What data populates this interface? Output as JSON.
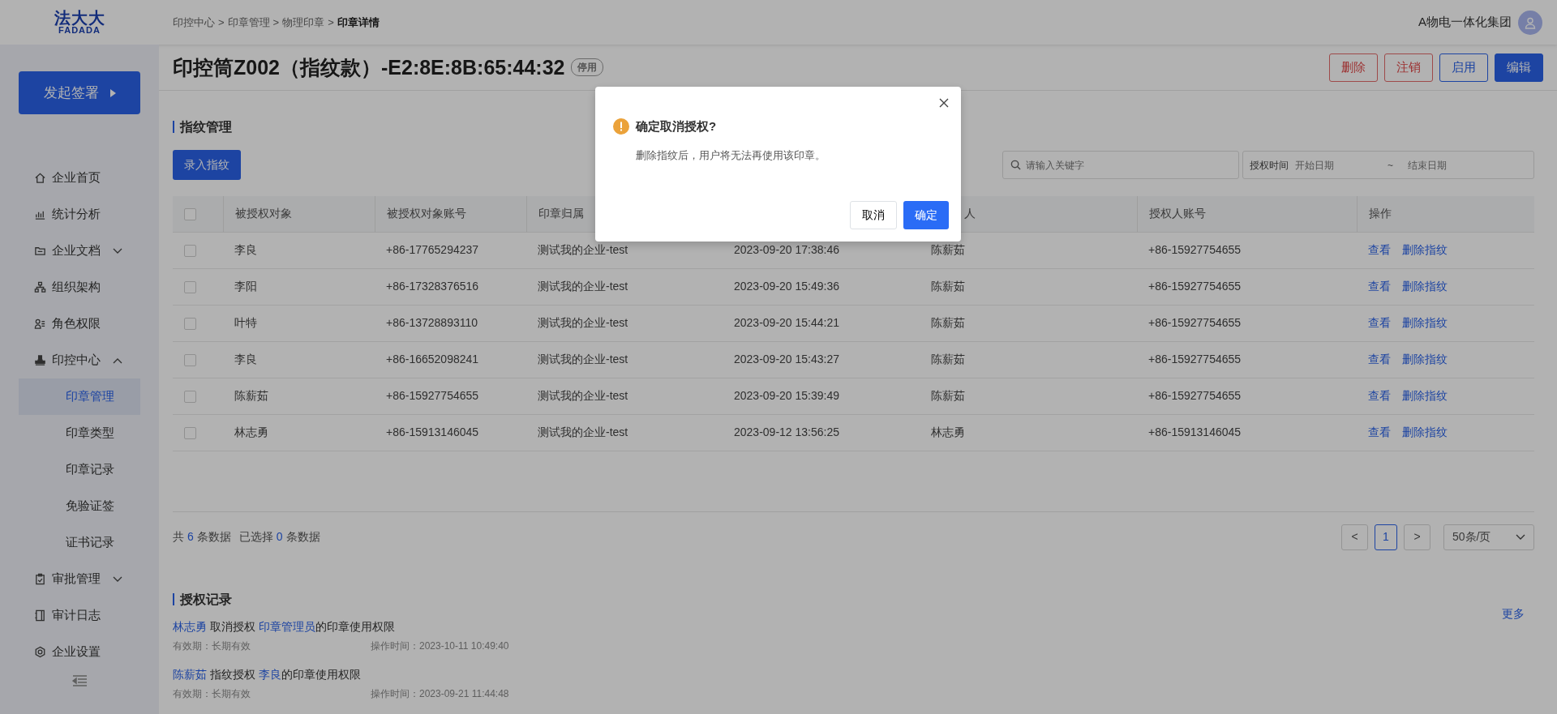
{
  "header": {
    "logo": {
      "cn": "法大大",
      "en": "FADADA"
    },
    "breadcrumb": [
      {
        "label": "印控中心",
        "current": false
      },
      {
        "label": "印章管理",
        "current": false
      },
      {
        "label": "物理印章",
        "current": false
      },
      {
        "label": "印章详情",
        "current": true
      }
    ],
    "separator": ">",
    "org_name": "A物电一体化集团"
  },
  "sidebar": {
    "primary_button": "发起签署",
    "items": [
      {
        "label": "企业首页",
        "kind": "home"
      },
      {
        "label": "统计分析",
        "kind": "chart"
      },
      {
        "label": "企业文档",
        "kind": "folder",
        "expanded": false
      },
      {
        "label": "组织架构",
        "kind": "org"
      },
      {
        "label": "角色权限",
        "kind": "role"
      },
      {
        "label": "印控中心",
        "kind": "stamp",
        "expanded": true,
        "children": [
          {
            "label": "印章管理",
            "selected": true
          },
          {
            "label": "印章类型",
            "selected": false
          },
          {
            "label": "印章记录",
            "selected": false
          },
          {
            "label": "免验证签",
            "selected": false
          },
          {
            "label": "证书记录",
            "selected": false
          }
        ]
      },
      {
        "label": "审批管理",
        "kind": "clipboard",
        "expanded": false
      },
      {
        "label": "审计日志",
        "kind": "book"
      },
      {
        "label": "企业设置",
        "kind": "gear"
      }
    ]
  },
  "page": {
    "title": "印控筒Z002（指纹款）-E2:8E:8B:65:44:32",
    "status_badge": "停用",
    "actions": [
      {
        "label": "删除",
        "kind": "danger"
      },
      {
        "label": "注销",
        "kind": "danger"
      },
      {
        "label": "启用",
        "kind": "outline"
      },
      {
        "label": "编辑",
        "kind": "primary"
      }
    ]
  },
  "fingerprints": {
    "title": "指纹管理",
    "add_button": "录入指纹",
    "search": {
      "placeholder": "请输入关键字"
    },
    "date_filter": {
      "label": "授权时间",
      "start_placeholder": "开始日期",
      "separator": "~",
      "end_placeholder": "结束日期"
    },
    "header_checked": false,
    "columns": [
      {
        "label": "被授权对象"
      },
      {
        "label": "被授权对象账号"
      },
      {
        "label": "印章归属"
      },
      {},
      {
        "label": "人"
      },
      {
        "label": "授权人账号"
      },
      {
        "label": "操作"
      }
    ],
    "rows": [
      {
        "checked": false,
        "cells": [
          "李良",
          "+86-17765294237",
          "测试我的企业-test",
          "2023-09-20 17:38:46",
          "陈薪茹",
          "+86-15927754655"
        ],
        "actions": [
          "查看",
          "删除指纹"
        ]
      },
      {
        "checked": false,
        "cells": [
          "李阳",
          "+86-17328376516",
          "测试我的企业-test",
          "2023-09-20 15:49:36",
          "陈薪茹",
          "+86-15927754655"
        ],
        "actions": [
          "查看",
          "删除指纹"
        ]
      },
      {
        "checked": false,
        "cells": [
          "叶特",
          "+86-13728893110",
          "测试我的企业-test",
          "2023-09-20 15:44:21",
          "陈薪茹",
          "+86-15927754655"
        ],
        "actions": [
          "查看",
          "删除指纹"
        ]
      },
      {
        "checked": false,
        "cells": [
          "李良",
          "+86-16652098241",
          "测试我的企业-test",
          "2023-09-20 15:43:27",
          "陈薪茹",
          "+86-15927754655"
        ],
        "actions": [
          "查看",
          "删除指纹"
        ]
      },
      {
        "checked": false,
        "cells": [
          "陈薪茹",
          "+86-15927754655",
          "测试我的企业-test",
          "2023-09-20 15:39:49",
          "陈薪茹",
          "+86-15927754655"
        ],
        "actions": [
          "查看",
          "删除指纹"
        ]
      },
      {
        "checked": false,
        "cells": [
          "林志勇",
          "+86-15913146045",
          "测试我的企业-test",
          "2023-09-12 13:56:25",
          "林志勇",
          "+86-15913146045"
        ],
        "actions": [
          "查看",
          "删除指纹"
        ]
      }
    ],
    "summary": {
      "total_prefix": "共",
      "total": "6",
      "total_suffix": "条数据",
      "selected_prefix": "已选择",
      "selected": "0",
      "selected_suffix": "条数据"
    },
    "pagination": {
      "prev": "<",
      "pages": [
        {
          "label": "1",
          "selected": true
        }
      ],
      "next": ">",
      "page_size": "50条/页"
    }
  },
  "records": {
    "title": "授权记录",
    "more": "更多",
    "entries": [
      {
        "actor": "林志勇",
        "action": "取消授权",
        "target": "印章管理员",
        "suffix": "的印章使用权限",
        "validity": "有效期：长期有效",
        "time": "操作时间：2023-10-11 10:49:40"
      },
      {
        "actor": "陈薪茹",
        "action": "指纹授权",
        "target": "李良",
        "suffix": "的印章使用权限",
        "validity": "有效期：长期有效",
        "time": "操作时间：2023-09-21 11:44:48"
      }
    ]
  },
  "dialog": {
    "title": "确定取消授权?",
    "message": "删除指纹后，用户将无法再使用该印章。",
    "cancel": "取消",
    "confirm": "确定"
  }
}
